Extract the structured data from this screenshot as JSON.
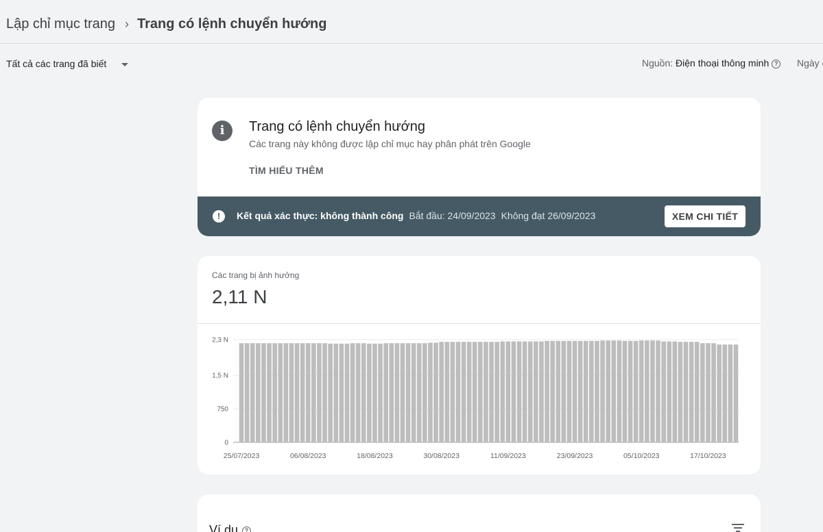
{
  "breadcrumb": {
    "parent": "Lập chỉ mục trang",
    "separator": "›",
    "current": "Trang có lệnh chuyển hướng"
  },
  "filter": {
    "pages_filter": "Tất cả các trang đã biết",
    "source_label": "Nguồn:",
    "source_value": "Điện thoại thông minh",
    "date_label": "Ngày c"
  },
  "issue_card": {
    "title": "Trang có lệnh chuyển hướng",
    "subtitle": "Các trang này không được lập chỉ mục hay phân phát trên Google",
    "learn_more": "TÌM HIỂU THÊM",
    "validation": {
      "status": "Kết quả xác thực: không thành công",
      "started": "Bắt đầu: 24/09/2023",
      "failed": "Không đạt 26/09/2023",
      "button": "XEM CHI TIẾT"
    },
    "colors": {
      "banner": "#455a64",
      "icon": "#5f6368"
    }
  },
  "affected": {
    "label": "Các trang bị ảnh hưởng",
    "value": "2,11 N"
  },
  "chart_data": {
    "type": "bar",
    "ylabel": "",
    "xlabel": "",
    "ylim": [
      0,
      2300
    ],
    "y_ticks": [
      "2,3 N",
      "1,5 N",
      "750",
      "0"
    ],
    "y_tick_values": [
      2300,
      1500,
      750,
      0
    ],
    "x_tick_labels": [
      "25/07/2023",
      "06/08/2023",
      "18/08/2023",
      "30/08/2023",
      "11/09/2023",
      "23/09/2023",
      "05/10/2023",
      "17/10/2023"
    ],
    "bar_color": "#bdbdbd",
    "start_date": "25/07/2023",
    "values": [
      2220,
      2220,
      2220,
      2220,
      2220,
      2220,
      2220,
      2220,
      2220,
      2220,
      2220,
      2220,
      2220,
      2220,
      2220,
      2220,
      2210,
      2210,
      2210,
      2210,
      2220,
      2220,
      2220,
      2210,
      2210,
      2210,
      2220,
      2220,
      2220,
      2220,
      2220,
      2220,
      2220,
      2220,
      2230,
      2230,
      2250,
      2250,
      2250,
      2250,
      2250,
      2250,
      2250,
      2250,
      2250,
      2250,
      2250,
      2260,
      2260,
      2260,
      2260,
      2260,
      2260,
      2260,
      2260,
      2270,
      2270,
      2270,
      2270,
      2270,
      2270,
      2270,
      2270,
      2270,
      2270,
      2280,
      2280,
      2280,
      2280,
      2270,
      2270,
      2270,
      2280,
      2280,
      2280,
      2280,
      2260,
      2260,
      2260,
      2250,
      2250,
      2250,
      2250,
      2220,
      2220,
      2220,
      2190,
      2190,
      2190,
      2190
    ]
  },
  "examples": {
    "title": "Ví dụ"
  }
}
